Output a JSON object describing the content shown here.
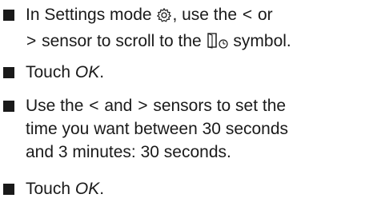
{
  "steps": [
    {
      "line1_a": "In Settings mode",
      "settings_icon": "gear-icon",
      "line1_b": ", use the",
      "lt": "<",
      "line1_c": "or",
      "gt": ">",
      "line2_a": "sensor to scroll to the",
      "door_icon": "door-timer-icon",
      "line2_b": "symbol."
    },
    {
      "prefix": "Touch ",
      "emph": "OK",
      "suffix": "."
    },
    {
      "line1_a": "Use the",
      "lt": "<",
      "line1_b": "and",
      "gt": ">",
      "line1_c": "sensors to set the",
      "line2": "time you want between 30 seconds",
      "line3": "and 3 minutes: 30 seconds."
    },
    {
      "prefix": "Touch ",
      "emph": "OK",
      "suffix": "."
    }
  ]
}
